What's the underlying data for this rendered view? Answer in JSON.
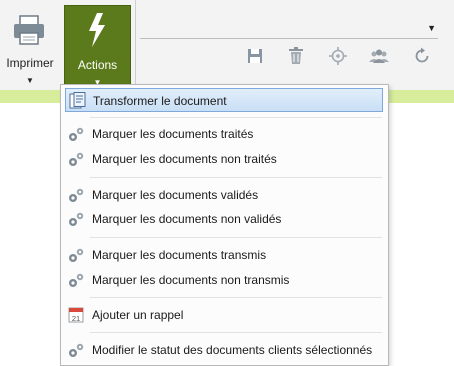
{
  "ribbon": {
    "print_label": "Imprimer",
    "actions_label": "Actions"
  },
  "toolbar_icons": [
    "save-icon",
    "trash-icon",
    "target-icon",
    "group-icon",
    "refresh-icon"
  ],
  "menu": {
    "items": [
      {
        "label": "Transformer le document",
        "icon": "document-transform-icon"
      },
      {
        "label": "Marquer les documents traités",
        "icon": "gears-icon"
      },
      {
        "label": "Marquer les documents non traités",
        "icon": "gears-icon"
      },
      {
        "label": "Marquer les documents validés",
        "icon": "gears-icon"
      },
      {
        "label": "Marquer les documents non validés",
        "icon": "gears-icon"
      },
      {
        "label": "Marquer les documents transmis",
        "icon": "gears-icon"
      },
      {
        "label": "Marquer les documents non transmis",
        "icon": "gears-icon"
      },
      {
        "label": "Ajouter un rappel",
        "icon": "calendar-icon",
        "icon_text": "21"
      },
      {
        "label": "Modifier le statut des documents clients sélectionnés",
        "icon": "gears-icon"
      }
    ]
  },
  "colors": {
    "actions_bg": "#5a7a1b",
    "strip": "#d7ed9b",
    "highlight_border": "#7fa9dc"
  }
}
